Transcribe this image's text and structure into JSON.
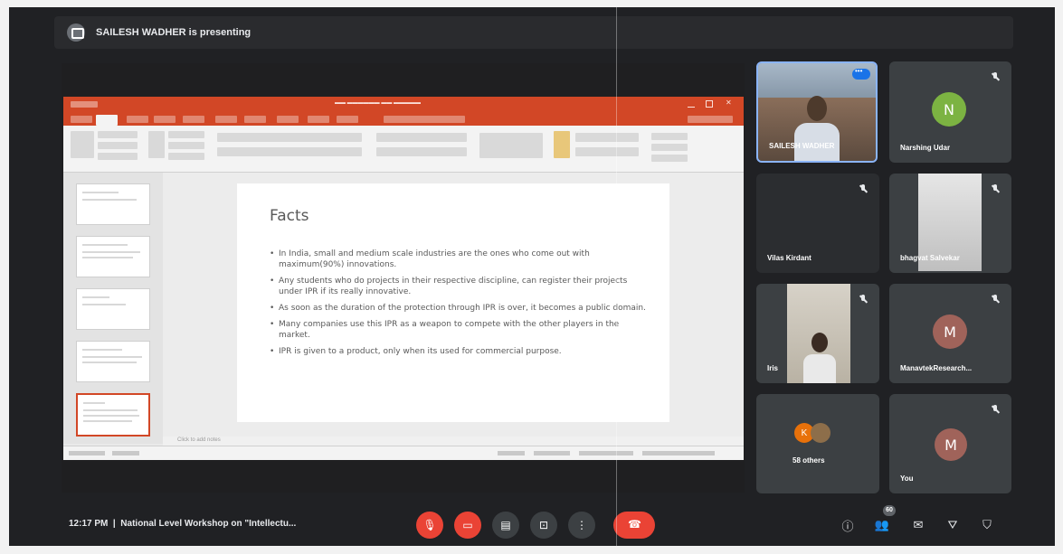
{
  "presenter": {
    "banner": "SAILESH WADHER is presenting"
  },
  "powerpoint": {
    "slide": {
      "title": "Facts",
      "bullets": [
        "In India, small and medium scale industries are the ones who come out with maximum(90%) innovations.",
        "Any students who do projects in their respective discipline, can register their projects under IPR if its really innovative.",
        "As soon as the duration of the protection through IPR is over, it becomes a public domain.",
        "Many companies use this IPR as a weapon to compete with the other players in the market.",
        "IPR is given to a product, only when its used for commercial purpose."
      ]
    },
    "notes_placeholder": "Click to add notes"
  },
  "participants": {
    "saileesh": {
      "name": "SAILESH WADHER"
    },
    "narshing": {
      "name": "Narshing Udar",
      "initial": "N",
      "color": "#7cb342"
    },
    "vilas": {
      "name": "Vilas Kirdant"
    },
    "bhagvat": {
      "name": "bhagvat Salvekar"
    },
    "iris": {
      "name": "Iris"
    },
    "manavtek": {
      "name": "ManavtekResearch...",
      "initial": "M",
      "color": "#a0635a"
    },
    "others": {
      "label": "58 others",
      "initial": "K",
      "color": "#e8710a"
    },
    "you": {
      "name": "You",
      "initial": "M",
      "color": "#a0635a"
    }
  },
  "bottom_bar": {
    "time": "12:17 PM",
    "separator": "|",
    "meeting_title": "National Level Workshop on \"Intellectu...",
    "people_count": "60"
  },
  "icons": {
    "mic": "mic-off-icon",
    "camera": "camera-off-icon",
    "captions": "captions-icon",
    "present": "present-screen-icon",
    "more": "more-options-icon",
    "leave": "leave-call-icon",
    "info": "info-icon",
    "people": "people-icon",
    "chat": "chat-icon",
    "activities": "activities-icon",
    "host": "host-controls-icon"
  },
  "colors": {
    "accent": "#1a73e8",
    "leave_red": "#ea4335",
    "ppt_orange": "#d24726"
  }
}
